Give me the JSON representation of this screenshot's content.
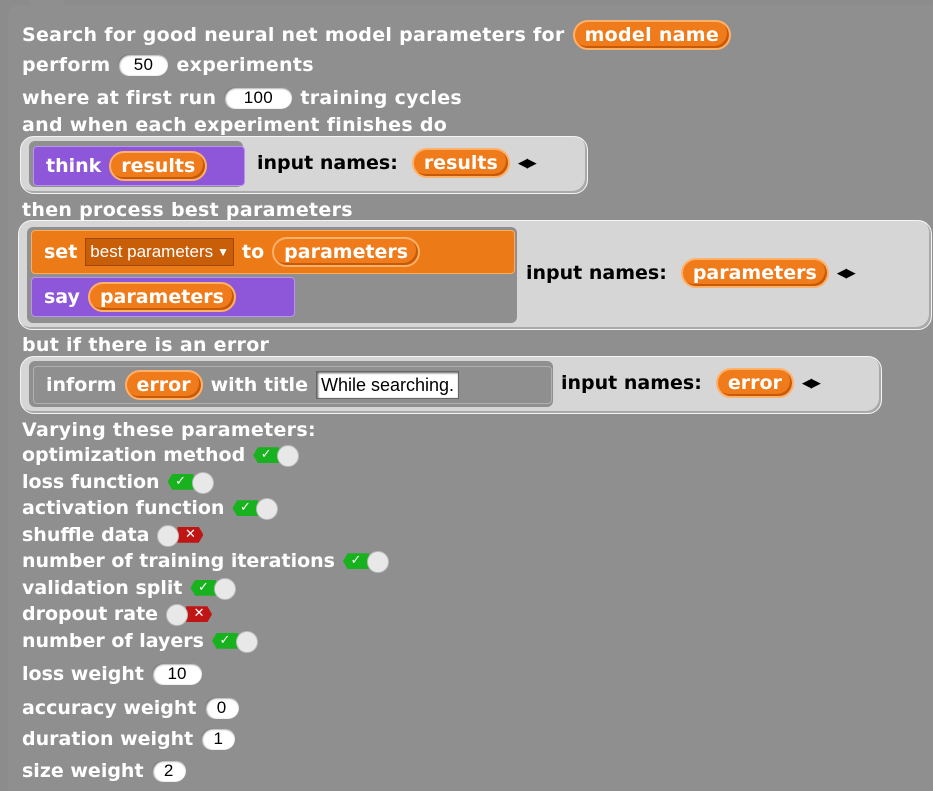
{
  "header": {
    "line1": "Search for good neural net model parameters for",
    "model_name": "model name",
    "perform": "perform",
    "experiments_count": "50",
    "experiments": "experiments",
    "where_first_run": "where at first run",
    "cycles_count": "100",
    "training_cycles": "training cycles",
    "when_finishes": "and when each experiment finishes do"
  },
  "finish_ring": {
    "think": "think",
    "results": "results",
    "input_names_label": "input names:",
    "input_name": "results"
  },
  "process_label": "then process best parameters",
  "best_ring": {
    "set": "set",
    "variable": "best parameters",
    "to": "to",
    "value": "parameters",
    "say": "say",
    "say_value": "parameters",
    "input_names_label": "input names:",
    "input_name": "parameters"
  },
  "error_label": "but if there is an error",
  "error_ring": {
    "inform": "inform",
    "error": "error",
    "with_title": "with title",
    "title_value": "While searching.",
    "input_names_label": "input names:",
    "input_name": "error"
  },
  "varying_label": "Varying these parameters:",
  "parameters": [
    {
      "label": "optimization method",
      "state": "on"
    },
    {
      "label": "loss function",
      "state": "on"
    },
    {
      "label": "activation function",
      "state": "on"
    },
    {
      "label": "shuffle data",
      "state": "off"
    },
    {
      "label": "number of training iterations",
      "state": "on"
    },
    {
      "label": "validation split",
      "state": "on"
    },
    {
      "label": "dropout rate",
      "state": "off"
    },
    {
      "label": "number of layers",
      "state": "on"
    }
  ],
  "weights": [
    {
      "label": "loss weight",
      "value": "10"
    },
    {
      "label": "accuracy weight",
      "value": "0"
    },
    {
      "label": "duration weight",
      "value": "1"
    },
    {
      "label": "size weight",
      "value": "2"
    }
  ],
  "toggle_glyphs": {
    "on": "✓",
    "off": "✕"
  },
  "colors": {
    "block_gray": "#8f8f8f",
    "ring_gray": "#d6d6d6",
    "reporter_orange": "#f07b1b",
    "looks_purple": "#8e57d9",
    "variables_orange": "#ec7b17",
    "toggle_on": "#19b21f",
    "toggle_off": "#c01515"
  }
}
